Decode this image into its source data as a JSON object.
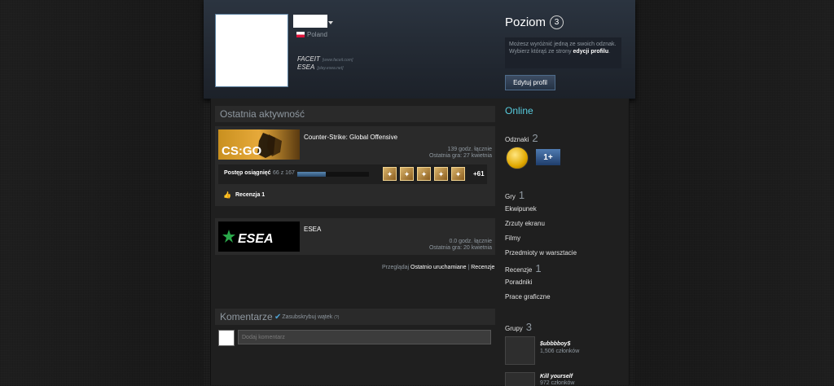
{
  "header": {
    "country": "Poland",
    "links": [
      {
        "name": "FACEIT",
        "url": "[www.faceit.com]"
      },
      {
        "name": "ESEA",
        "url": "[play.esea.net]"
      }
    ],
    "level_label": "Poziom",
    "level_value": "3",
    "badge_hint_text": "Możesz wyróżnić jedną ze swoich odznak. Wybierz którąś ze strony",
    "badge_hint_link": "edycji profilu",
    "badge_hint_end": ".",
    "edit_button": "Edytuj profil"
  },
  "activity": {
    "title": "Ostatnia aktywność",
    "games": [
      {
        "name": "Counter-Strike: Global Offensive",
        "hours": "139 godz. łącznie",
        "last": "Ostatnia gra: 27 kwietnia"
      },
      {
        "name": "ESEA",
        "hours": "0.0 godz. łącznie",
        "last": "Ostatnia gra: 20 kwietnia"
      }
    ],
    "cs_logo": "CS:GO",
    "esea_logo": "ESEA",
    "achievements": {
      "label": "Postęp osiągnięć",
      "count": "66 z 167",
      "progress": 0.395,
      "more": "+61"
    },
    "review": "Recenzja 1",
    "footer": {
      "browse": "Przeglądaj",
      "recent": "Ostatnio uruchamiane",
      "sep": "|",
      "reviews": "Recenzje"
    }
  },
  "comments": {
    "title": "Komentarze",
    "subscribe": "Zasubskrybuj wątek",
    "subscribe_sup": "(?)",
    "placeholder": "Dodaj komentarz"
  },
  "sidebar": {
    "status": "Online",
    "badges_label": "Odznaki",
    "badges_count": "2",
    "badge_1plus": "1+",
    "games_label": "Gry",
    "games_count": "1",
    "items": [
      "Ekwipunek",
      "Zrzuty ekranu",
      "Filmy",
      "Przedmioty w warsztacie"
    ],
    "reviews_label": "Recenzje",
    "reviews_count": "1",
    "items2": [
      "Poradniki",
      "Prace graficzne"
    ],
    "groups_label": "Grupy",
    "groups_count": "3",
    "groups": [
      {
        "name": "$ubbbboy$",
        "members": "1,506 członków"
      },
      {
        "name": "Kill yourself",
        "members": "972 członków"
      }
    ]
  },
  "colors": {
    "accent": "#57cbde",
    "header_bg": "#2b3440",
    "panel_bg": "#2a2a2a"
  }
}
